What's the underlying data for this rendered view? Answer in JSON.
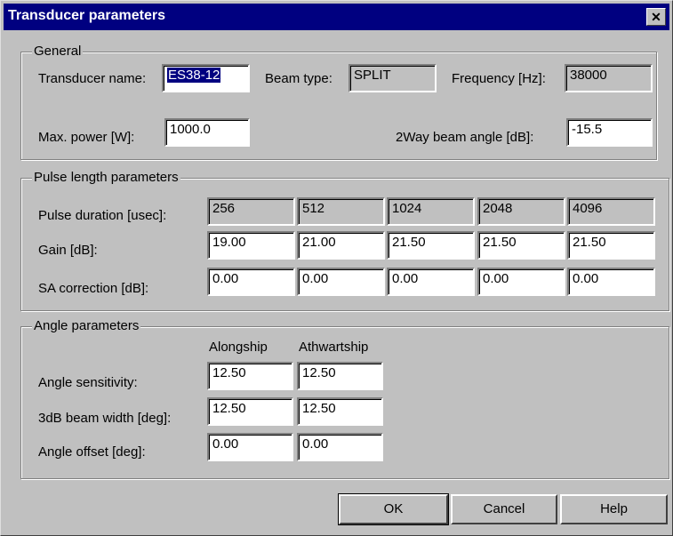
{
  "window": {
    "title": "Transducer parameters",
    "close_glyph": "✕"
  },
  "general": {
    "legend": "General",
    "transducer_name_label": "Transducer name:",
    "transducer_name_value": "ES38-12",
    "beam_type_label": "Beam type:",
    "beam_type_value": "SPLIT",
    "frequency_label": "Frequency [Hz]:",
    "frequency_value": "38000",
    "max_power_label": "Max. power [W]:",
    "max_power_value": "1000.0",
    "beam_angle_label": "2Way beam angle [dB]:",
    "beam_angle_value": "-15.5"
  },
  "pulse": {
    "legend": "Pulse length parameters",
    "duration_label": "Pulse duration [usec]:",
    "durations": [
      "256",
      "512",
      "1024",
      "2048",
      "4096"
    ],
    "gain_label": "Gain [dB]:",
    "gains": [
      "19.00",
      "21.00",
      "21.50",
      "21.50",
      "21.50"
    ],
    "sa_label": "SA correction [dB]:",
    "sa_corrections": [
      "0.00",
      "0.00",
      "0.00",
      "0.00",
      "0.00"
    ]
  },
  "angle": {
    "legend": "Angle parameters",
    "col_alongship": "Alongship",
    "col_athwartship": "Athwartship",
    "sensitivity_label": "Angle sensitivity:",
    "sensitivity": [
      "12.50",
      "12.50"
    ],
    "beam_width_label": "3dB beam width [deg]:",
    "beam_width": [
      "12.50",
      "12.50"
    ],
    "offset_label": "Angle offset [deg]:",
    "offset": [
      "0.00",
      "0.00"
    ]
  },
  "buttons": {
    "ok": "OK",
    "cancel": "Cancel",
    "help": "Help"
  }
}
